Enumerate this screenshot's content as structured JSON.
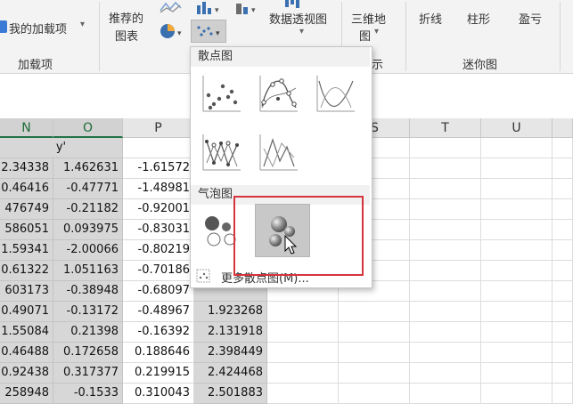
{
  "ribbon": {
    "my_addins_label": "我的加载项",
    "addins_group_label": "加载项",
    "recommended_charts_label_line1": "推荐的",
    "recommended_charts_label_line2": "图表",
    "pivot_chart_label": "数据透视图",
    "map_label_line1": "三维地",
    "map_label_line2": "图",
    "partial_group_label": "示",
    "sparkline_line_label": "折线",
    "sparkline_column_label": "柱形",
    "sparkline_winloss_label": "盈亏",
    "sparklines_group_label": "迷你图"
  },
  "sheet": {
    "columns": [
      "N",
      "O",
      "P",
      "S",
      "T",
      "U"
    ],
    "header_row_label": "y'",
    "rows": [
      {
        "n": "2.34338",
        "o": "1.462631",
        "p": "-1.61572",
        "q": ""
      },
      {
        "n": "0.46416",
        "o": "-0.47771",
        "p": "-1.48981",
        "q": ""
      },
      {
        "n": "476749",
        "o": "-0.21182",
        "p": "-0.92001",
        "q": ""
      },
      {
        "n": "586051",
        "o": "0.093975",
        "p": "-0.83031",
        "q": ""
      },
      {
        "n": "1.59341",
        "o": "-2.00066",
        "p": "-0.80219",
        "q": ""
      },
      {
        "n": "0.61322",
        "o": "1.051163",
        "p": "-0.70186",
        "q": ""
      },
      {
        "n": "603173",
        "o": "-0.38948",
        "p": "-0.68097",
        "q": ""
      },
      {
        "n": "0.49071",
        "o": "-0.13172",
        "p": "-0.48967",
        "q": "1.923268"
      },
      {
        "n": "1.55084",
        "o": "0.21398",
        "p": "-0.16392",
        "q": "2.131918"
      },
      {
        "n": "0.46488",
        "o": "0.172658",
        "p": "0.188646",
        "q": "2.398449"
      },
      {
        "n": "0.92438",
        "o": "0.317377",
        "p": "0.219915",
        "q": "2.424468"
      },
      {
        "n": "258948",
        "o": "-0.1533",
        "p": "0.310043",
        "q": "2.501883"
      }
    ]
  },
  "dropdown": {
    "scatter_header": "散点图",
    "bubble_header": "气泡图",
    "more_scatter_label": "更多散点图(M)..."
  },
  "colors": {
    "highlight_box": "#d6343c",
    "selected_cell_bg": "#d7d7d7",
    "excel_green": "#217346"
  }
}
